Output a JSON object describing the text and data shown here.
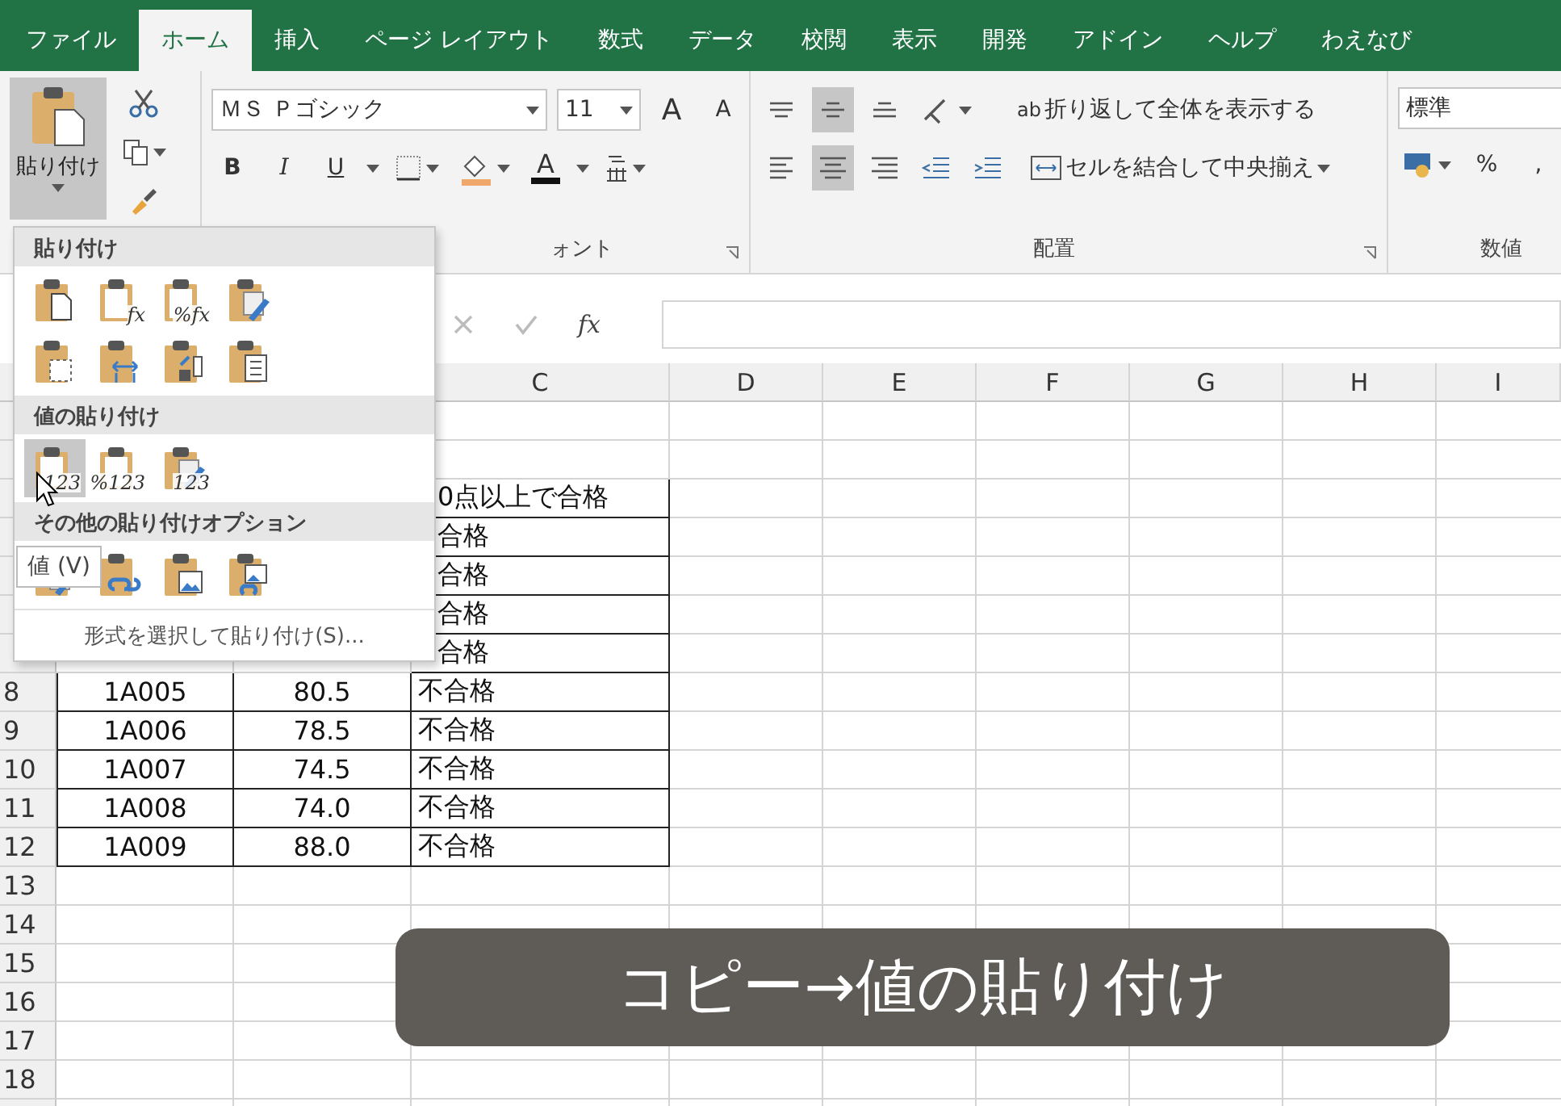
{
  "tabs": [
    {
      "label": "ファイル",
      "selected": false
    },
    {
      "label": "ホーム",
      "selected": true
    },
    {
      "label": "挿入",
      "selected": false
    },
    {
      "label": "ページ レイアウト",
      "selected": false
    },
    {
      "label": "数式",
      "selected": false
    },
    {
      "label": "データ",
      "selected": false
    },
    {
      "label": "校閲",
      "selected": false
    },
    {
      "label": "表示",
      "selected": false
    },
    {
      "label": "開発",
      "selected": false
    },
    {
      "label": "アドイン",
      "selected": false
    },
    {
      "label": "ヘルプ",
      "selected": false
    },
    {
      "label": "わえなび",
      "selected": false
    }
  ],
  "ribbon": {
    "clipboard": {
      "paste_label": "貼り付け",
      "paste_pressed": true
    },
    "font": {
      "name": "ＭＳ Ｐゴシック",
      "size": "11",
      "grow": "A",
      "shrink": "A",
      "bold": "B",
      "italic": "I",
      "underline": "U",
      "color_letter": "A",
      "group_label": "ォント"
    },
    "alignment": {
      "top_row": [
        {
          "kind": "top",
          "selected": false
        },
        {
          "kind": "middle",
          "selected": true
        },
        {
          "kind": "bottom",
          "selected": false
        }
      ],
      "bottom_row": [
        {
          "kind": "left",
          "selected": false
        },
        {
          "kind": "center",
          "selected": true
        },
        {
          "kind": "right",
          "selected": false
        }
      ],
      "wrap_icon": "ab",
      "wrap": "折り返して全体を表示する",
      "merge": "セルを結合して中央揃え",
      "group_label": "配置"
    },
    "number": {
      "format": "標準",
      "percent": "%",
      "comma": ",",
      "group_label": "数値"
    }
  },
  "formula_bar": {
    "fx": "fx"
  },
  "columns": [
    "C",
    "D",
    "E",
    "F",
    "G",
    "H",
    "I"
  ],
  "rows": [
    {},
    {},
    {
      "c": "0点以上で合格"
    },
    {
      "c": "合格"
    },
    {
      "c": "合格"
    },
    {
      "c": "合格"
    },
    {
      "c": "合格"
    },
    {
      "number": "8",
      "a": "1A005",
      "b": "80.5",
      "c": "不合格"
    },
    {
      "number": "9",
      "a": "1A006",
      "b": "78.5",
      "c": "不合格"
    },
    {
      "number": "10",
      "a": "1A007",
      "b": "74.5",
      "c": "不合格"
    },
    {
      "number": "11",
      "a": "1A008",
      "b": "74.0",
      "c": "不合格"
    },
    {
      "number": "12",
      "a": "1A009",
      "b": "88.0",
      "c": "不合格"
    },
    {
      "number": "13"
    },
    {
      "number": "14"
    },
    {
      "number": "15"
    },
    {
      "number": "16"
    },
    {
      "number": "17"
    },
    {
      "number": "18"
    }
  ],
  "paste_menu": {
    "sections": [
      {
        "title": "貼り付け",
        "options": [
          {
            "kind": "doc",
            "selected": false
          },
          {
            "kind": "glyph",
            "glyph": "fx",
            "selected": false
          },
          {
            "kind": "glyph",
            "glyph": "%fx",
            "selected": false
          },
          {
            "kind": "brush",
            "selected": false
          },
          {
            "kind": "dotted",
            "selected": false
          },
          {
            "kind": "arrows",
            "selected": false
          },
          {
            "kind": "swap",
            "selected": false
          },
          {
            "kind": "list",
            "selected": false
          }
        ]
      },
      {
        "title": "値の貼り付け",
        "options": [
          {
            "kind": "glyph",
            "glyph": "123",
            "selected": true
          },
          {
            "kind": "glyph",
            "glyph": "%123",
            "selected": false
          },
          {
            "kind": "brush-values",
            "glyph": "123",
            "selected": false
          }
        ]
      },
      {
        "title": "その他の貼り付けオプション",
        "options": [
          {
            "kind": "brush",
            "selected": false
          },
          {
            "kind": "link",
            "selected": false
          },
          {
            "kind": "picture",
            "selected": false
          },
          {
            "kind": "picture-link",
            "selected": false
          }
        ]
      }
    ],
    "footer": "形式を選択して貼り付け(S)..."
  },
  "tooltip": "値 (V)",
  "caption": "コピー→値の貼り付け"
}
